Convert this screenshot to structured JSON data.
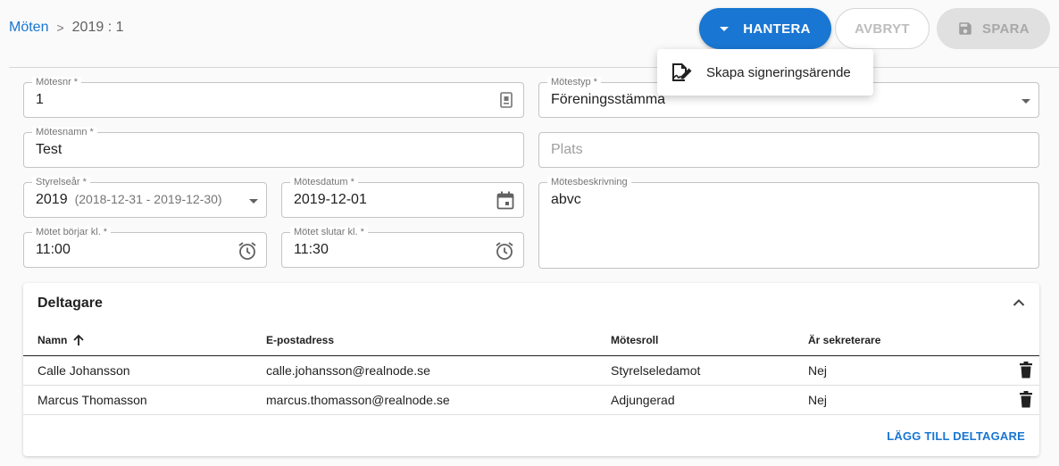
{
  "breadcrumb": {
    "parent": "Möten",
    "separator": ">",
    "current": "2019 : 1"
  },
  "toolbar": {
    "hantera_label": "HANTERA",
    "avbryt_label": "AVBRYT",
    "spara_label": "SPARA"
  },
  "menu": {
    "items": [
      {
        "label": "Skapa signeringsärende",
        "icon": "signature-icon"
      }
    ]
  },
  "form": {
    "motesnr": {
      "label": "Mötesnr *",
      "value": "1"
    },
    "motestyp": {
      "label": "Mötestyp *",
      "value": "Föreningsstämma"
    },
    "motesnamn": {
      "label": "Mötesnamn *",
      "value": "Test"
    },
    "plats": {
      "placeholder": "Plats",
      "value": ""
    },
    "styrelsear": {
      "label": "Styrelseår *",
      "value": "2019",
      "range": "(2018-12-31 - 2019-12-30)"
    },
    "motesdatum": {
      "label": "Mötesdatum *",
      "value": "2019-12-01"
    },
    "motesbeskrivning": {
      "label": "Mötesbeskrivning",
      "value": "abvc"
    },
    "borjar": {
      "label": "Mötet börjar kl. *",
      "value": "11:00"
    },
    "slutar": {
      "label": "Mötet slutar kl. *",
      "value": "11:30"
    }
  },
  "participants": {
    "title": "Deltagare",
    "columns": [
      "Namn",
      "E-postadress",
      "Mötesroll",
      "Är sekreterare"
    ],
    "sort": {
      "column": "Namn",
      "direction": "ascending"
    },
    "rows": [
      {
        "name": "Calle Johansson",
        "email": "calle.johansson@realnode.se",
        "role": "Styrelseledamot",
        "secretary": "Nej"
      },
      {
        "name": "Marcus Thomasson",
        "email": "marcus.thomasson@realnode.se",
        "role": "Adjungerad",
        "secretary": "Nej"
      }
    ],
    "add_label": "LÄGG TILL DELTAGARE"
  },
  "colors": {
    "primary": "#1976d2",
    "disabled_bg": "#e0e0e0",
    "border": "#c4c4c4"
  }
}
